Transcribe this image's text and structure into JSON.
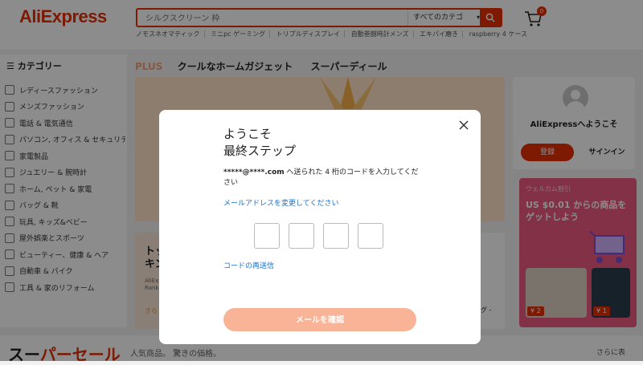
{
  "header": {
    "logo": "AliExpress",
    "search": {
      "placeholder": "シルクスクリーン 枠",
      "category": "すべてのカテゴ",
      "category_chevron": "▾"
    },
    "cart_count": "0",
    "hot_words": [
      "ノモスネオマティック",
      "ミニpc ゲーミング",
      "トリプルディスプレイ",
      "自動巻腕時計メンズ",
      "エキパイ磨き",
      "raspberry 4 ケース"
    ]
  },
  "sidebar": {
    "title": "カテゴリー",
    "items": [
      {
        "label": "レディースファッション",
        "icon": "dress-icon"
      },
      {
        "label": "メンズファッション",
        "icon": "shirt-icon"
      },
      {
        "label": "電話 & 電気通信",
        "icon": "phone-icon"
      },
      {
        "label": "パソコン, オフィス & セキュリテ…",
        "icon": "computer-icon"
      },
      {
        "label": "家電製品",
        "icon": "appliance-icon"
      },
      {
        "label": "ジュエリー & 腕時計",
        "icon": "jewelry-icon"
      },
      {
        "label": "ホーム, ペット & 家電",
        "icon": "home-icon"
      },
      {
        "label": "バッグ & 靴",
        "icon": "bag-icon"
      },
      {
        "label": "玩具, キッズ&ベビー",
        "icon": "toy-icon"
      },
      {
        "label": "屋外娯楽とスポーツ",
        "icon": "sports-icon"
      },
      {
        "label": "ビューティー、健康 & ヘア",
        "icon": "beauty-icon"
      },
      {
        "label": "自動車 & バイク",
        "icon": "car-icon"
      },
      {
        "label": "工具 & 家のリフォーム",
        "icon": "tools-icon"
      }
    ]
  },
  "nav": {
    "plus": "PLUS",
    "tabs": [
      "クールなホームガジェット",
      "スーパーディール"
    ]
  },
  "tiles": {
    "left_title": "トッ\nキン",
    "left_sub": "AliEx\nRank",
    "left_more": "さら",
    "right_title": "ング -\nグ"
  },
  "right_panel": {
    "welcome": "AliExpressへようこそ",
    "register": "登録",
    "signin": "サインイン",
    "promo_tag": "ウェルカム割引",
    "promo_text": "US $0.01 からの商品をゲットしよう",
    "price1": "¥ 2",
    "price2": "¥ 1"
  },
  "bottom": {
    "super_black": "スー",
    "super_red": "パーセール",
    "sub": "人気商品。 驚きの価格。",
    "more": "さらに表"
  },
  "modal": {
    "title_line1": "ようこそ",
    "title_line2": "最終ステップ",
    "email_masked": "*****@****.com",
    "desc_rest": " へ送られた 4 桁のコードを入力してください",
    "change_email": "メールアドレスを変更してください",
    "resend": "コードの再送信",
    "confirm": "メールを確認"
  },
  "colors": {
    "brand": "#e62e04",
    "link": "#1a6fd0",
    "confirm_disabled": "#f9b396"
  }
}
